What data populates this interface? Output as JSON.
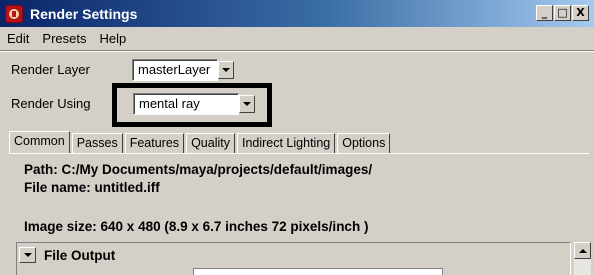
{
  "window": {
    "title": "Render Settings",
    "buttons": [
      "_",
      "□",
      "X"
    ]
  },
  "menu": [
    "Edit",
    "Presets",
    "Help"
  ],
  "render_layer": {
    "label": "Render Layer",
    "value": "masterLayer"
  },
  "render_using": {
    "label": "Render Using",
    "value": "mental ray"
  },
  "tabs": [
    "Common",
    "Passes",
    "Features",
    "Quality",
    "Indirect Lighting",
    "Options"
  ],
  "active_tab": "Common",
  "info": {
    "path": "Path: C:/My Documents/maya/projects/default/images/",
    "file_name": "File name:  untitled.iff",
    "image_size": "Image size: 640 x 480 (8.9 x 6.7 inches 72 pixels/inch )"
  },
  "section": {
    "title": "File Output",
    "expanded": true
  },
  "icons": {
    "app": "maya-app-icon",
    "dropdown": "chevron-down-icon",
    "collapse": "collapse-triangle-icon",
    "scroll_up": "scroll-up-icon"
  },
  "colors": {
    "titlebar_start": "#0a246a",
    "titlebar_end": "#a6caf0",
    "window_bg": "#d4d0c8",
    "highlight_border": "#000000"
  }
}
